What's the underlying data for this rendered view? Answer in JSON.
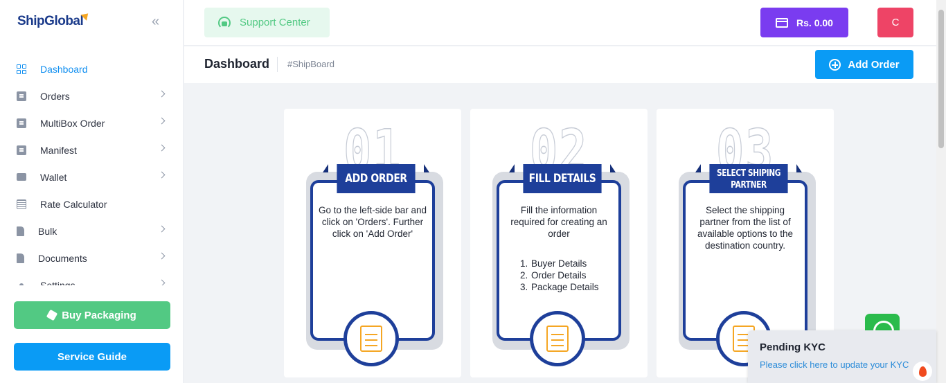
{
  "brand": {
    "logo_text": "ShipGlobal"
  },
  "sidebar": {
    "collapse_glyph": "«",
    "items": [
      {
        "label": "Dashboard",
        "icon": "dashboard-grid-icon",
        "active": true,
        "has_submenu": false
      },
      {
        "label": "Orders",
        "icon": "orders-icon",
        "active": false,
        "has_submenu": true
      },
      {
        "label": "MultiBox Order",
        "icon": "multibox-icon",
        "active": false,
        "has_submenu": true
      },
      {
        "label": "Manifest",
        "icon": "manifest-icon",
        "active": false,
        "has_submenu": true
      },
      {
        "label": "Wallet",
        "icon": "wallet-icon",
        "active": false,
        "has_submenu": true
      },
      {
        "label": "Rate Calculator",
        "icon": "calculator-icon",
        "active": false,
        "has_submenu": false
      },
      {
        "label": "Bulk",
        "icon": "bulk-file-icon",
        "active": false,
        "has_submenu": true
      },
      {
        "label": "Documents",
        "icon": "documents-file-icon",
        "active": false,
        "has_submenu": true
      },
      {
        "label": "Settings",
        "icon": "settings-icon",
        "active": false,
        "has_submenu": true
      }
    ],
    "buy_packaging_label": "Buy Packaging",
    "service_guide_label": "Service Guide"
  },
  "topbar": {
    "support_label": "Support Center",
    "wallet_balance": "Rs. 0.00",
    "avatar_initial": "C"
  },
  "page": {
    "title": "Dashboard",
    "tag": "#ShipBoard",
    "add_order_label": "Add Order"
  },
  "steps": [
    {
      "number": "01",
      "title": "ADD ORDER",
      "description": "Go to the left-side bar and click on 'Orders'. Further click on 'Add Order'",
      "list": []
    },
    {
      "number": "02",
      "title": "FILL DETAILS",
      "description": "Fill the information required for creating an order",
      "list": [
        "Buyer Details",
        "Order Details",
        "Package Details"
      ]
    },
    {
      "number": "03",
      "title": "SELECT SHIPING PARTNER",
      "description": "Select the shipping partner from the list of available options to the destination country.",
      "list": []
    }
  ],
  "kyc": {
    "title": "Pending KYC",
    "link": "Please click here to update your KYC"
  },
  "colors": {
    "primary": "#0a9bf5",
    "green": "#52c983",
    "purple": "#7a3cf0",
    "avatar": "#ee4466",
    "navy": "#1e3f9a",
    "accent_orange": "#f5a623"
  }
}
